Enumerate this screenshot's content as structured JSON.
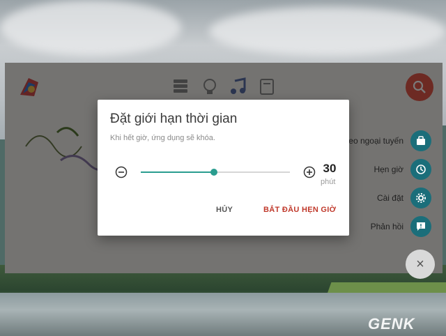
{
  "app": {
    "top_icons": [
      "books-icon",
      "lightbulb-icon",
      "music-icon",
      "notebook-icon"
    ],
    "search_icon": "search-icon",
    "brand_color": "#e3584a"
  },
  "fab_menu": {
    "items": [
      {
        "label": "Video ngoại tuyến",
        "icon": "briefcase-icon"
      },
      {
        "label": "Hẹn giờ",
        "icon": "clock-icon"
      },
      {
        "label": "Cài đặt",
        "icon": "gear-icon"
      },
      {
        "label": "Phản hồi",
        "icon": "feedback-icon"
      }
    ],
    "close_label": "×",
    "fab_color": "#1b6e7a"
  },
  "dialog": {
    "title": "Đặt giới hạn thời gian",
    "subtitle": "Khi hết giờ, ứng dụng sẽ khóa.",
    "slider": {
      "value": 30,
      "fraction": 0.49,
      "accent": "#2a9d8f"
    },
    "value_text": "30",
    "unit": "phút",
    "cancel_label": "HỦY",
    "start_label": "BẮT ĐẦU HẸN GIỜ",
    "start_color": "#c0392b"
  }
}
